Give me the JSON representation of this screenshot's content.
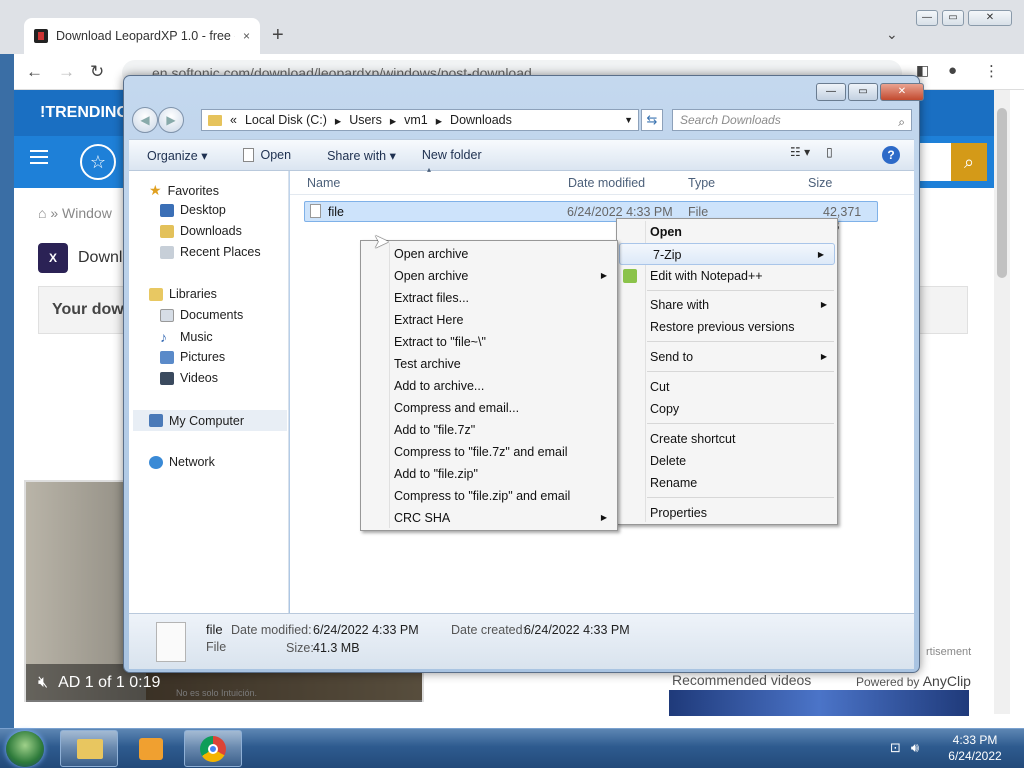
{
  "browser": {
    "tab_title": "Download LeopardXP 1.0 - free -",
    "tab_close": "×",
    "new_tab": "+",
    "url": "en.softonic.com/download/leopardxp/windows/post-download",
    "nav": {
      "back": "←",
      "forward": "→",
      "reload": "↻"
    }
  },
  "site": {
    "trending": "!TRENDING",
    "breadcrumb": "» Window",
    "download_title": "Downl",
    "your_download": "Your dow",
    "advertisement": "rtisement",
    "recommended_videos": "Recommended videos",
    "powered_by": "Powered by",
    "anyclip": "AnyClip",
    "ad_label": "AD 1 of 1  0:19",
    "video_caption": "No es solo Intuición."
  },
  "explorer": {
    "address": {
      "prefix": "«",
      "crumbs": [
        "Local Disk (C:)",
        "Users",
        "vm1",
        "Downloads"
      ]
    },
    "search_placeholder": "Search Downloads",
    "toolbar": {
      "organize": "Organize ▾",
      "open": "Open",
      "share_with": "Share with ▾",
      "new_folder": "New folder"
    },
    "nav": {
      "favorites": "Favorites",
      "desktop": "Desktop",
      "downloads": "Downloads",
      "recent": "Recent Places",
      "libraries": "Libraries",
      "documents": "Documents",
      "music": "Music",
      "pictures": "Pictures",
      "videos": "Videos",
      "computer": "My Computer",
      "network": "Network"
    },
    "columns": {
      "name": "Name",
      "date": "Date modified",
      "type": "Type",
      "size": "Size"
    },
    "file": {
      "name": "file",
      "date": "6/24/2022 4:33 PM",
      "type": "File",
      "size": "42,371 KB"
    },
    "details": {
      "name": "file",
      "type": "File",
      "date_modified_label": "Date modified:",
      "date_modified": "6/24/2022 4:33 PM",
      "date_created_label": "Date created:",
      "date_created": "6/24/2022 4:33 PM",
      "size_label": "Size:",
      "size": "41.3 MB"
    }
  },
  "context_menu": {
    "open": "Open",
    "zip": "7-Zip",
    "notepad": "Edit with Notepad++",
    "share_with": "Share with",
    "restore": "Restore previous versions",
    "send_to": "Send to",
    "cut": "Cut",
    "copy": "Copy",
    "create_shortcut": "Create shortcut",
    "delete": "Delete",
    "rename": "Rename",
    "properties": "Properties"
  },
  "zip_menu": [
    "Open archive",
    "Open archive",
    "Extract files...",
    "Extract Here",
    "Extract to \"file~\\\"",
    "Test archive",
    "Add to archive...",
    "Compress and email...",
    "Add to \"file.7z\"",
    "Compress to \"file.7z\" and email",
    "Add to \"file.zip\"",
    "Compress to \"file.zip\" and email",
    "CRC SHA"
  ],
  "taskbar": {
    "time": "4:33 PM",
    "date": "6/24/2022"
  }
}
